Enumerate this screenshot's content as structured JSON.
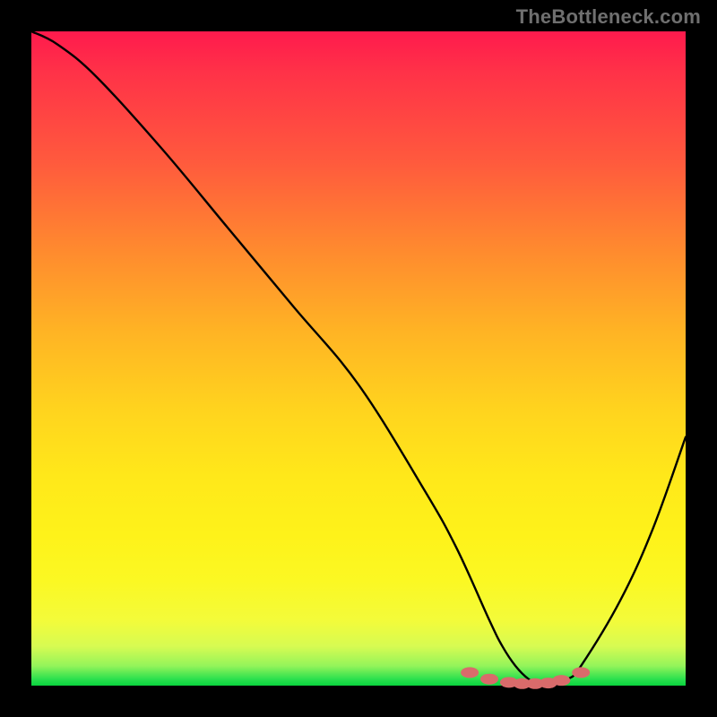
{
  "watermark": "TheBottleneck.com",
  "chart_data": {
    "type": "line",
    "title": "",
    "xlabel": "",
    "ylabel": "",
    "xlim": [
      0,
      100
    ],
    "ylim": [
      0,
      100
    ],
    "series": [
      {
        "name": "bottleneck-curve",
        "x": [
          0,
          4,
          10,
          20,
          30,
          40,
          50,
          60,
          65,
          70,
          72,
          74,
          76,
          78,
          80,
          82,
          84,
          90,
          95,
          100
        ],
        "values": [
          100,
          98,
          93,
          82,
          70,
          58,
          46,
          30,
          21,
          10,
          6,
          3,
          1,
          0,
          0,
          1,
          3,
          13,
          24,
          38
        ]
      }
    ],
    "markers": {
      "name": "highlight-dots",
      "x": [
        67,
        70,
        73,
        75,
        77,
        79,
        81,
        84
      ],
      "values": [
        2,
        1,
        0.5,
        0.3,
        0.3,
        0.4,
        0.8,
        2
      ]
    },
    "colors": {
      "curve": "#000000",
      "marker": "#d96b6b",
      "gradient_top": "#ff1a4d",
      "gradient_mid": "#ffe81a",
      "gradient_bottom": "#0ad43e"
    }
  }
}
